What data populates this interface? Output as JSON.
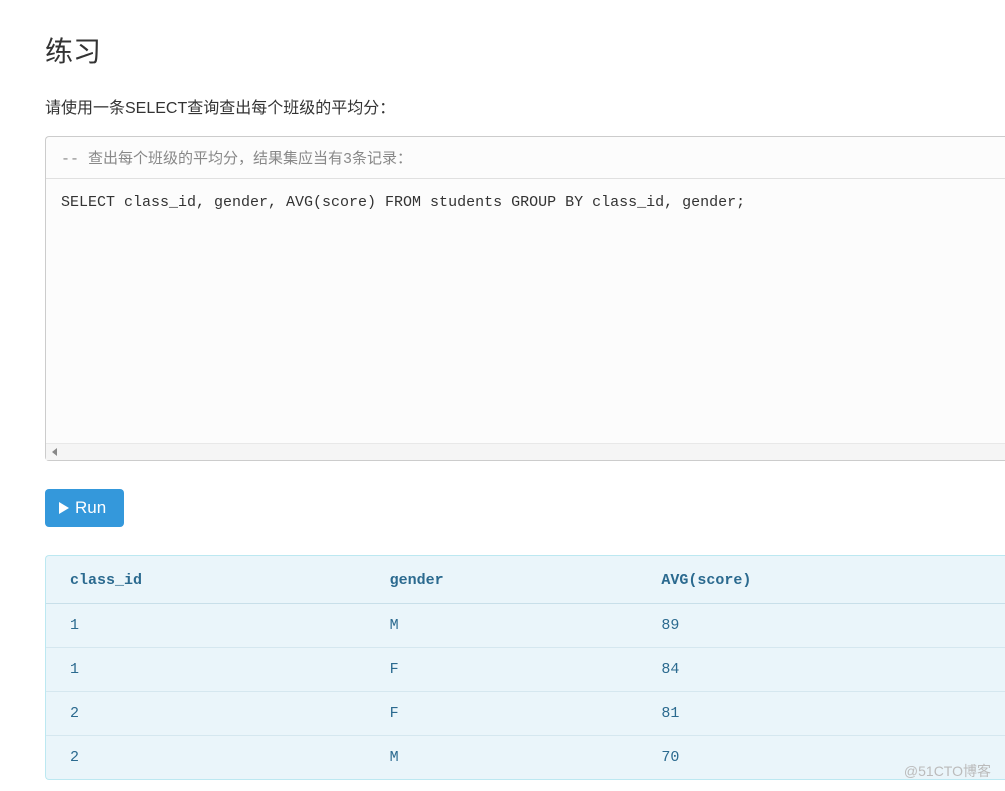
{
  "heading": "练习",
  "description": "请使用一条SELECT查询查出每个班级的平均分：",
  "code": {
    "comment": "-- 查出每个班级的平均分，结果集应当有3条记录：",
    "sql": "SELECT class_id, gender, AVG(score) FROM students GROUP BY class_id, gender;"
  },
  "run_button": "Run",
  "result": {
    "columns": [
      "class_id",
      "gender",
      "AVG(score)"
    ],
    "rows": [
      [
        "1",
        "M",
        "89"
      ],
      [
        "1",
        "F",
        "84"
      ],
      [
        "2",
        "F",
        "81"
      ],
      [
        "2",
        "M",
        "70"
      ]
    ]
  },
  "watermark": "@51CTO博客"
}
